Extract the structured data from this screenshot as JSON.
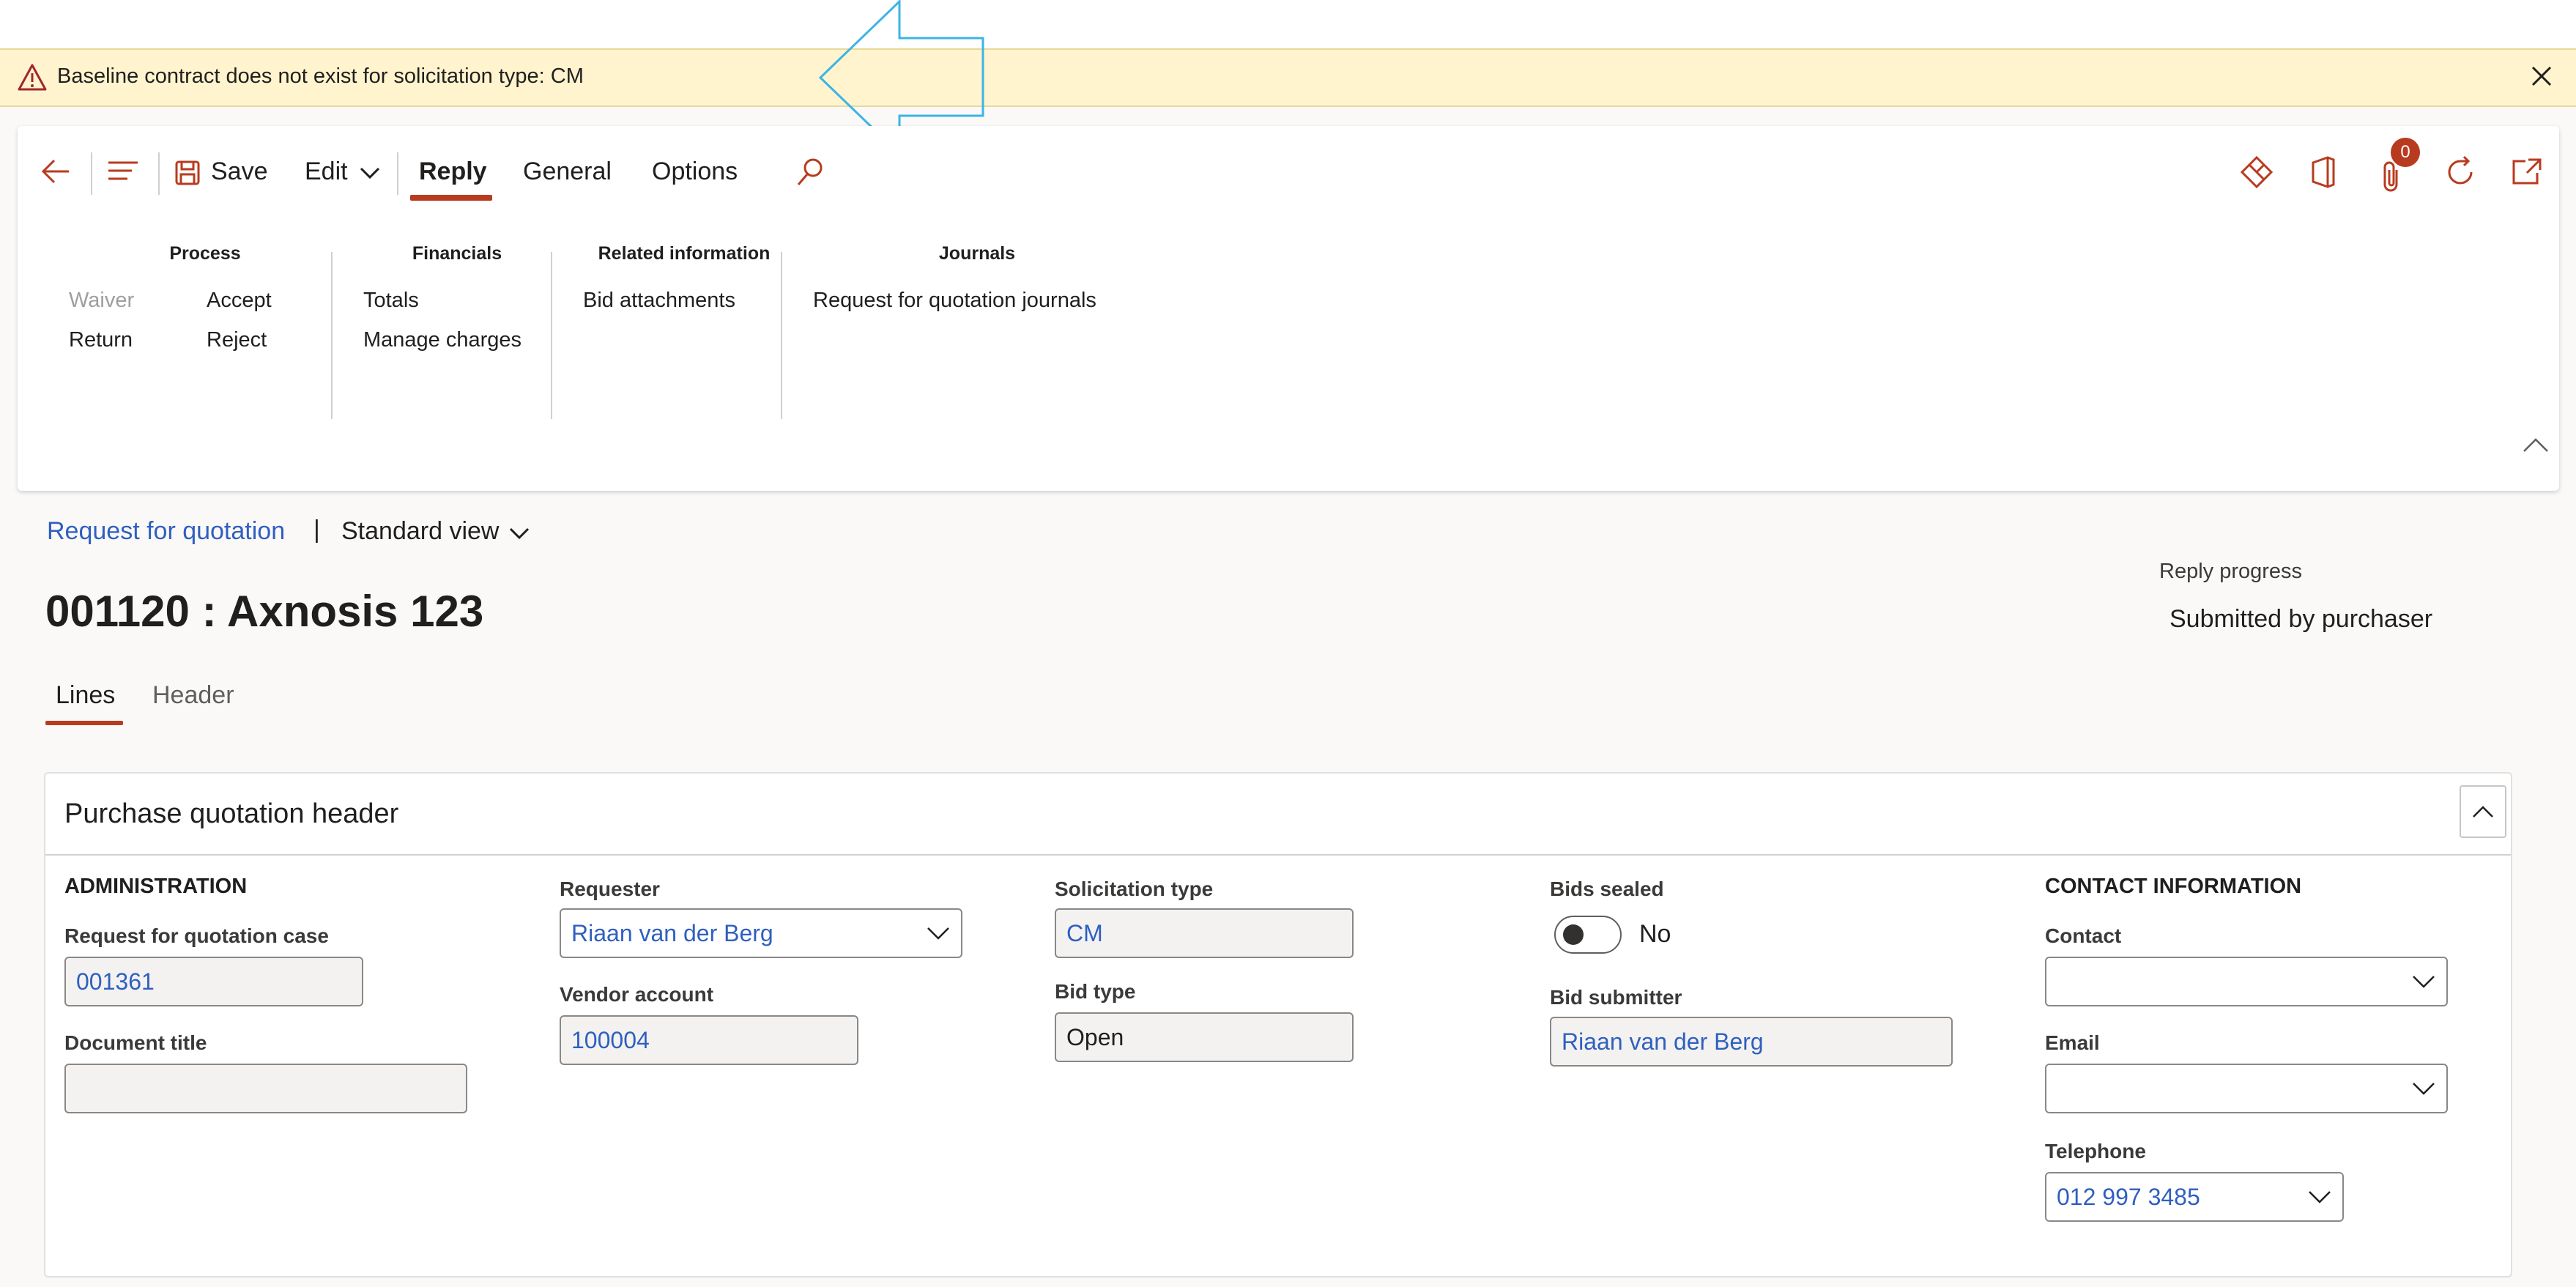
{
  "warning": {
    "message": "Baseline contract does not exist for solicitation type: CM"
  },
  "toolbar": {
    "save_label": "Save",
    "edit_label": "Edit",
    "tabs": [
      "Reply",
      "General",
      "Options"
    ],
    "attachments_count": "0"
  },
  "groups": {
    "process": {
      "title": "Process",
      "items": [
        "Waiver",
        "Accept",
        "Return",
        "Reject"
      ]
    },
    "financials": {
      "title": "Financials",
      "items": [
        "Totals",
        "Manage charges"
      ]
    },
    "related": {
      "title": "Related information",
      "items": [
        "Bid attachments"
      ]
    },
    "journals": {
      "title": "Journals",
      "items": [
        "Request for quotation journals"
      ]
    }
  },
  "breadcrumb": {
    "link": "Request for quotation",
    "separator": "|",
    "view": "Standard view"
  },
  "page": {
    "title": "001120 : Axnosis 123"
  },
  "reply_progress": {
    "label": "Reply progress",
    "value": "Submitted by purchaser"
  },
  "page_tabs": [
    "Lines",
    "Header"
  ],
  "card": {
    "title": "Purchase quotation header",
    "administration": {
      "heading": "ADMINISTRATION",
      "rfq_case_label": "Request for quotation case",
      "rfq_case_value": "001361",
      "document_title_label": "Document title",
      "document_title_value": ""
    },
    "requester": {
      "label": "Requester",
      "value": "Riaan van der Berg"
    },
    "vendor_account": {
      "label": "Vendor account",
      "value": "100004"
    },
    "solicitation_type": {
      "label": "Solicitation type",
      "value": "CM"
    },
    "bid_type": {
      "label": "Bid type",
      "value": "Open"
    },
    "bids_sealed": {
      "label": "Bids sealed",
      "value": "No"
    },
    "bid_submitter": {
      "label": "Bid submitter",
      "value": "Riaan van der Berg"
    },
    "contact_information": {
      "heading": "CONTACT INFORMATION",
      "contact_label": "Contact",
      "contact_value": "",
      "email_label": "Email",
      "email_value": "",
      "telephone_label": "Telephone",
      "telephone_value": "012 997 3485"
    }
  },
  "colors": {
    "accent": "#b83b1f",
    "link": "#2f5fbf",
    "warning_bg": "#fff4ce",
    "annotation_arrow": "#3cb4e6"
  }
}
